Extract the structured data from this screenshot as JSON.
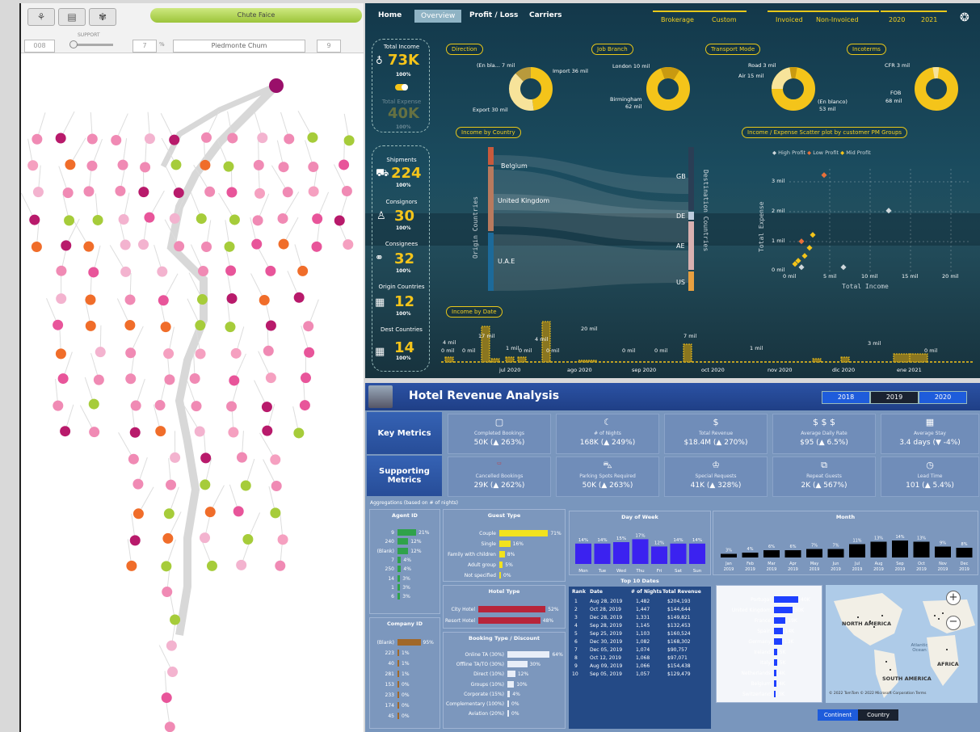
{
  "tree_app": {
    "title": "Chute Faice",
    "support_label": "SUPPORT",
    "min_value": "008",
    "step_value": "7",
    "select_value": "Piedmonte Chum",
    "pct_value": "9",
    "percent_sign": "%"
  },
  "freight": {
    "nav": [
      "Home",
      "Overview",
      "Profit / Loss",
      "Carriers"
    ],
    "filters": [
      "Brokerage",
      "Custom",
      "Invoiced",
      "Non-Invoiced",
      "2020",
      "2021"
    ],
    "kpis": [
      {
        "label": "Total Income",
        "value": "73K",
        "pct": "100%"
      },
      {
        "label": "Total Expense",
        "value": "40K",
        "pct": "100%"
      },
      {
        "label": "Shipments",
        "value": "224",
        "pct": "100%"
      },
      {
        "label": "Consignors",
        "value": "30",
        "pct": "100%"
      },
      {
        "label": "Consignees",
        "value": "32",
        "pct": "100%"
      },
      {
        "label": "Origin Countries",
        "value": "12",
        "pct": "100%"
      },
      {
        "label": "Dest Countries",
        "value": "14",
        "pct": "100%"
      }
    ],
    "donuts": [
      {
        "title": "Direction",
        "labels": [
          "(En bla... 7 mil",
          "Import 36 mil",
          "Export 30 mil"
        ]
      },
      {
        "title": "Job Branch",
        "labels": [
          "London 10 mil",
          "Birmingham",
          "62 mil"
        ]
      },
      {
        "title": "Transport Mode",
        "labels": [
          "Road 3 mil",
          "Air 15 mil",
          "(En blanco)",
          "53 mil"
        ]
      },
      {
        "title": "Incoterms",
        "labels": [
          "CFR 3 mil",
          "FOB",
          "68 mil"
        ]
      }
    ],
    "sankey": {
      "title": "Income by Country",
      "origin_axis": "Origin Countries",
      "dest_axis": "Destination Countries",
      "origins": [
        "Belgium",
        "United Kingdom",
        "U.A.E"
      ],
      "dests": [
        "GB",
        "DE",
        "AE",
        "US"
      ]
    },
    "scatter": {
      "title": "Income / Expense Scatter plot by customer PM Groups",
      "legend": [
        "High Profit",
        "Low Profit",
        "Mid Profit"
      ],
      "xlabel": "Total Income",
      "ylabel": "Total Expense",
      "xticks": [
        "0 mil",
        "5 mil",
        "10 mil",
        "15 mil",
        "20 mil"
      ],
      "yticks": [
        "0 mil",
        "1 mil",
        "2 mil",
        "3 mil"
      ]
    },
    "timeline": {
      "title": "Income by Date",
      "xticks": [
        "jul 2020",
        "ago 2020",
        "sep 2020",
        "oct 2020",
        "nov 2020",
        "dic 2020",
        "ene 2021"
      ],
      "labels": [
        "4 mil",
        "0 mil",
        "0 mil",
        "17 mil",
        "1 mil",
        "0 mil",
        "4 mil",
        "0 mil",
        "20 mil",
        "0 mil",
        "0 mil",
        "7 mil",
        "1 mil",
        "3 mil",
        "0 mil"
      ]
    }
  },
  "hotel": {
    "title": "Hotel Revenue Analysis",
    "years": [
      "2018",
      "2019",
      "2020"
    ],
    "side": [
      "Key Metrics",
      "Supporting Metrics"
    ],
    "key_cards": [
      {
        "label": "Completed Bookings",
        "value": "50K (▲ 263%)"
      },
      {
        "label": "# of Nights",
        "value": "168K (▲ 249%)"
      },
      {
        "label": "Total Revenue",
        "value": "$18.4M (▲ 270%)"
      },
      {
        "label": "Average Daily Rate",
        "value": "$95 (▲ 6.5%)"
      },
      {
        "label": "Average Stay",
        "value": "3.4 days (▼ -4%)"
      }
    ],
    "support_cards": [
      {
        "label": "Cancelled Bookings",
        "value": "29K (▲ 262%)"
      },
      {
        "label": "Parking Spots Required",
        "value": "50K (▲ 263%)"
      },
      {
        "label": "Special Requests",
        "value": "41K (▲ 328%)"
      },
      {
        "label": "Repeat Guests",
        "value": "2K (▲ 567%)"
      },
      {
        "label": "Lead Time",
        "value": "101 (▲ 5.4%)"
      }
    ],
    "aggregation_note": "Aggregations (based on # of nights)",
    "agent": {
      "title": "Agent ID",
      "rows": [
        [
          "9",
          "21%"
        ],
        [
          "240",
          "12%"
        ],
        [
          "(Blank)",
          "12%"
        ],
        [
          "7",
          "4%"
        ],
        [
          "250",
          "4%"
        ],
        [
          "14",
          "3%"
        ],
        [
          "1",
          "3%"
        ],
        [
          "6",
          "3%"
        ]
      ]
    },
    "company": {
      "title": "Company ID",
      "rows": [
        [
          "(Blank)",
          "95%"
        ],
        [
          "223",
          "1%"
        ],
        [
          "40",
          "1%"
        ],
        [
          "281",
          "1%"
        ],
        [
          "153",
          "0%"
        ],
        [
          "233",
          "0%"
        ],
        [
          "174",
          "0%"
        ],
        [
          "45",
          "0%"
        ]
      ]
    },
    "guest": {
      "title": "Guest Type",
      "rows": [
        [
          "Couple",
          "71%"
        ],
        [
          "Single",
          "16%"
        ],
        [
          "Family with children",
          "8%"
        ],
        [
          "Adult group",
          "5%"
        ],
        [
          "Not specified",
          "0%"
        ]
      ]
    },
    "hoteltype": {
      "title": "Hotel Type",
      "rows": [
        [
          "City Hotel",
          "52%"
        ],
        [
          "Resort Hotel",
          "48%"
        ]
      ]
    },
    "booking": {
      "title": "Booking Type / Discount",
      "rows": [
        [
          "Online TA (30%)",
          "64%"
        ],
        [
          "Offline TA/TO (30%)",
          "30%"
        ],
        [
          "Direct (10%)",
          "12%"
        ],
        [
          "Groups (10%)",
          "10%"
        ],
        [
          "Corporate (15%)",
          "4%"
        ],
        [
          "Complementary (100%)",
          "0%"
        ],
        [
          "Aviation (20%)",
          "0%"
        ]
      ]
    },
    "dow": {
      "title": "Day of Week",
      "days": [
        "Mon",
        "Tue",
        "Wed",
        "Thu",
        "Fri",
        "Sat",
        "Sun"
      ],
      "values": [
        "14%",
        "14%",
        "15%",
        "17%",
        "12%",
        "14%",
        "14%"
      ]
    },
    "month": {
      "title": "Month",
      "months": [
        "Jan 2019",
        "Feb 2019",
        "Mar 2019",
        "Apr 2019",
        "May 2019",
        "Jun 2019",
        "Jul 2019",
        "Aug 2019",
        "Sep 2019",
        "Oct 2019",
        "Nov 2019",
        "Dec 2019"
      ],
      "values": [
        "3%",
        "4%",
        "6%",
        "6%",
        "7%",
        "7%",
        "11%",
        "13%",
        "14%",
        "13%",
        "9%",
        "8%"
      ]
    },
    "top10": {
      "title": "Top 10 Dates",
      "headers": [
        "Rank",
        "Date",
        "# of Nights",
        "Total Revenue"
      ],
      "rows": [
        [
          "1",
          "Aug 28, 2019",
          "1,482",
          "$204,193"
        ],
        [
          "2",
          "Oct 28, 2019",
          "1,447",
          "$144,644"
        ],
        [
          "3",
          "Dec 28, 2019",
          "1,331",
          "$149,821"
        ],
        [
          "4",
          "Sep 28, 2019",
          "1,145",
          "$132,453"
        ],
        [
          "5",
          "Sep 25, 2019",
          "1,103",
          "$160,524"
        ],
        [
          "6",
          "Dec 30, 2019",
          "1,082",
          "$168,302"
        ],
        [
          "7",
          "Dec 05, 2019",
          "1,074",
          "$90,757"
        ],
        [
          "8",
          "Oct 12, 2019",
          "1,068",
          "$97,071"
        ],
        [
          "9",
          "Aug 09, 2019",
          "1,066",
          "$154,438"
        ],
        [
          "10",
          "Sep 05, 2019",
          "1,057",
          "$129,479"
        ]
      ]
    },
    "country": {
      "rows": [
        [
          "Portugal",
          "40K"
        ],
        [
          "United Kingdom",
          "30K"
        ],
        [
          "France",
          "19K"
        ],
        [
          "Spain",
          "14K"
        ],
        [
          "Germany",
          "13K"
        ],
        [
          "Ireland",
          "5K"
        ],
        [
          "Italy",
          "5K"
        ],
        [
          "Netherlands",
          "4K"
        ],
        [
          "Belgium",
          "4K"
        ],
        [
          "Switzerland",
          "3K"
        ]
      ]
    },
    "map": {
      "labels": [
        "NORTH AMERICA",
        "SOUTH AMERICA",
        "AFRICA",
        "Atlantic Ocean"
      ],
      "copyright": "© 2022 TomTom © 2022 Microsoft Corporation  Terms"
    },
    "map_tabs": [
      "Continent",
      "Country"
    ]
  }
}
